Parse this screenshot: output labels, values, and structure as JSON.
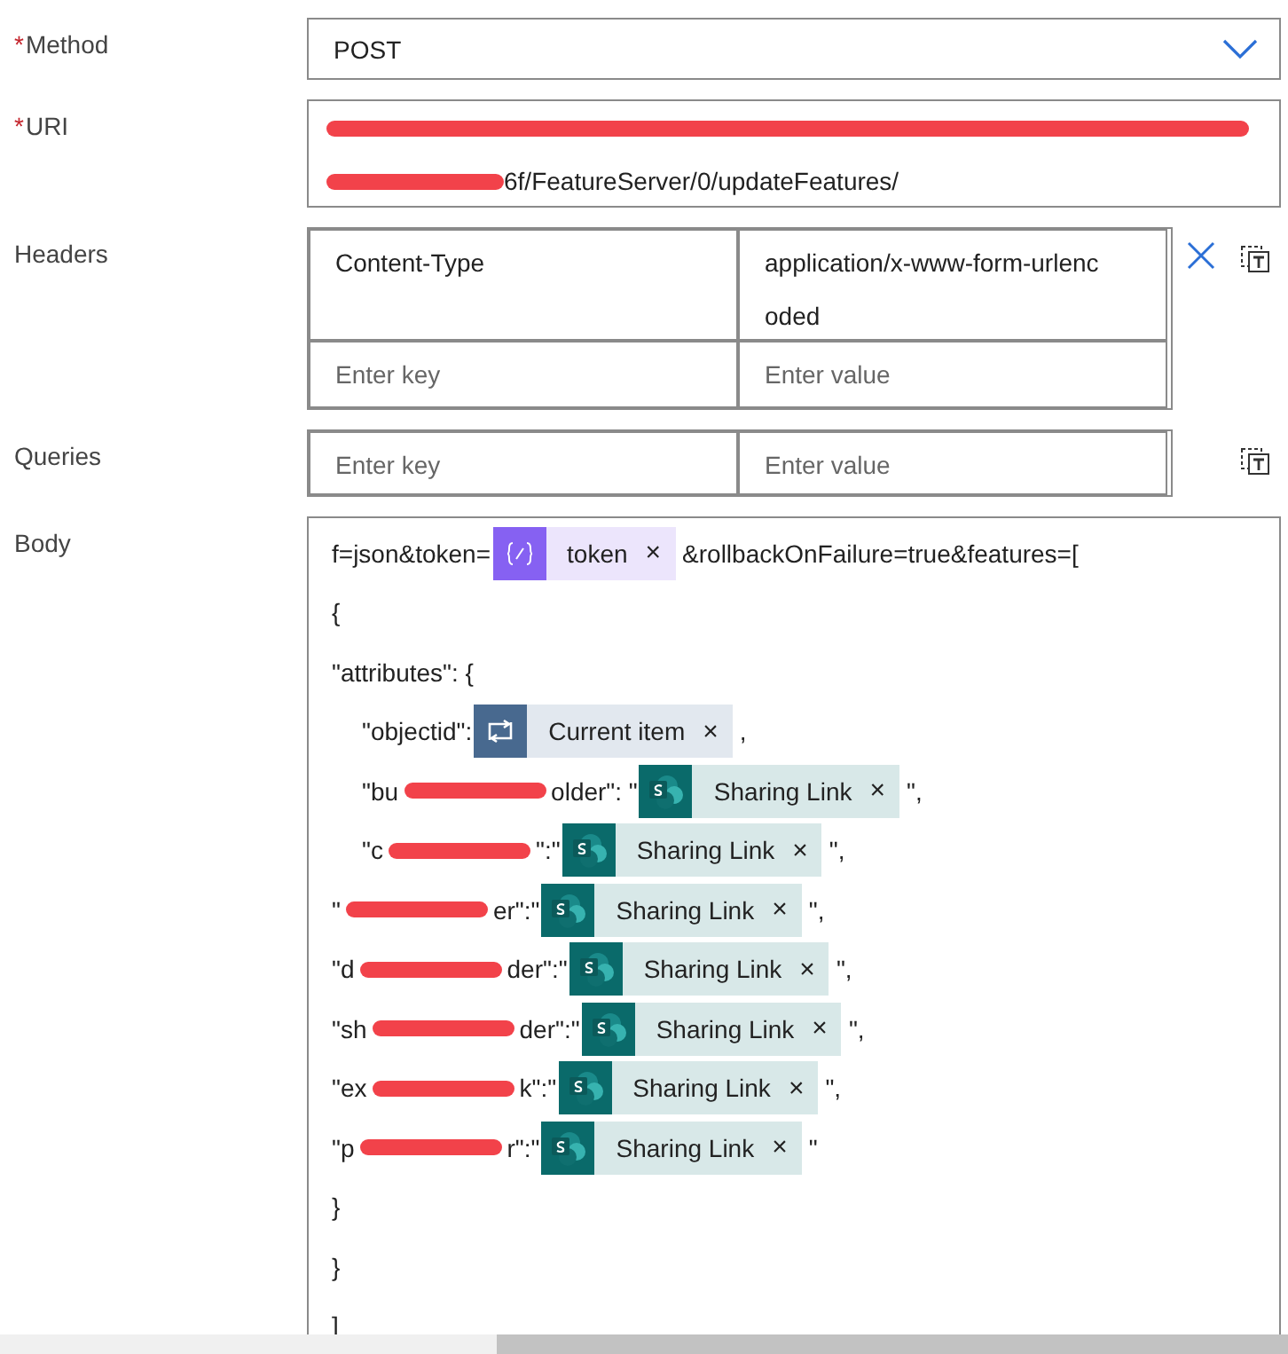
{
  "method": {
    "label": "Method",
    "required_mark": "*",
    "value": "POST"
  },
  "uri": {
    "label": "URI",
    "required_mark": "*",
    "lines": [
      [
        {
          "kind": "redacted"
        }
      ],
      [
        {
          "kind": "redacted"
        },
        {
          "kind": "text",
          "text": "6f/FeatureServer/0/updateFeatures/"
        }
      ]
    ]
  },
  "headers": {
    "label": "Headers",
    "rows": [
      {
        "key": "Content-Type",
        "value": "application/x-www-form-urlencoded"
      }
    ],
    "key_placeholder": "Enter key",
    "value_placeholder": "Enter value"
  },
  "queries": {
    "label": "Queries",
    "key_placeholder": "Enter key",
    "value_placeholder": "Enter value"
  },
  "body": {
    "label": "Body",
    "lines": [
      {
        "indented": false,
        "parts": [
          {
            "kind": "text",
            "text": "f=json&token="
          },
          {
            "kind": "variable_token",
            "text": "token",
            "remove": "×"
          },
          {
            "kind": "text",
            "text": "&rollbackOnFailure=true&features=["
          }
        ]
      },
      {
        "indented": false,
        "parts": [
          {
            "kind": "text",
            "text": "{"
          }
        ]
      },
      {
        "indented": false,
        "parts": [
          {
            "kind": "text",
            "text": "\"attributes\": {"
          }
        ]
      },
      {
        "indented": true,
        "parts": [
          {
            "kind": "text",
            "text": "\"objectid\":"
          },
          {
            "kind": "loop_token",
            "text": "Current item",
            "remove": "×"
          },
          {
            "kind": "text",
            "text": ","
          }
        ]
      },
      {
        "indented": true,
        "parts": [
          {
            "kind": "text",
            "text": "\"bu"
          },
          {
            "kind": "redacted"
          },
          {
            "kind": "text",
            "text": "older\": \""
          },
          {
            "kind": "sharepoint_token",
            "text": "Sharing Link",
            "remove": "×"
          },
          {
            "kind": "text",
            "text": "\","
          }
        ]
      },
      {
        "indented": true,
        "parts": [
          {
            "kind": "text",
            "text": "\"c"
          },
          {
            "kind": "redacted"
          },
          {
            "kind": "text",
            "text": "\":\""
          },
          {
            "kind": "sharepoint_token",
            "text": "Sharing Link",
            "remove": "×"
          },
          {
            "kind": "text",
            "text": "\","
          }
        ]
      },
      {
        "indented": false,
        "parts": [
          {
            "kind": "text",
            "text": "\""
          },
          {
            "kind": "redacted"
          },
          {
            "kind": "text",
            "text": "er\":\""
          },
          {
            "kind": "sharepoint_token",
            "text": "Sharing Link",
            "remove": "×"
          },
          {
            "kind": "text",
            "text": "\","
          }
        ]
      },
      {
        "indented": false,
        "parts": [
          {
            "kind": "text",
            "text": "\"d"
          },
          {
            "kind": "redacted"
          },
          {
            "kind": "text",
            "text": "der\":\""
          },
          {
            "kind": "sharepoint_token",
            "text": "Sharing Link",
            "remove": "×"
          },
          {
            "kind": "text",
            "text": "\","
          }
        ]
      },
      {
        "indented": false,
        "parts": [
          {
            "kind": "text",
            "text": "\"sh"
          },
          {
            "kind": "redacted"
          },
          {
            "kind": "text",
            "text": "der\":\""
          },
          {
            "kind": "sharepoint_token",
            "text": "Sharing Link",
            "remove": "×"
          },
          {
            "kind": "text",
            "text": "\","
          }
        ]
      },
      {
        "indented": false,
        "parts": [
          {
            "kind": "text",
            "text": "\"ex"
          },
          {
            "kind": "redacted"
          },
          {
            "kind": "text",
            "text": "k\":\""
          },
          {
            "kind": "sharepoint_token",
            "text": "Sharing Link",
            "remove": "×"
          },
          {
            "kind": "text",
            "text": "\","
          }
        ]
      },
      {
        "indented": false,
        "parts": [
          {
            "kind": "text",
            "text": "\"p"
          },
          {
            "kind": "redacted"
          },
          {
            "kind": "text",
            "text": "r\":\""
          },
          {
            "kind": "sharepoint_token",
            "text": "Sharing Link",
            "remove": "×"
          },
          {
            "kind": "text",
            "text": "\""
          }
        ]
      },
      {
        "indented": false,
        "parts": [
          {
            "kind": "text",
            "text": "}"
          }
        ]
      },
      {
        "indented": false,
        "parts": [
          {
            "kind": "text",
            "text": "}"
          }
        ]
      },
      {
        "indented": false,
        "parts": [
          {
            "kind": "text",
            "text": "]"
          }
        ]
      }
    ]
  }
}
